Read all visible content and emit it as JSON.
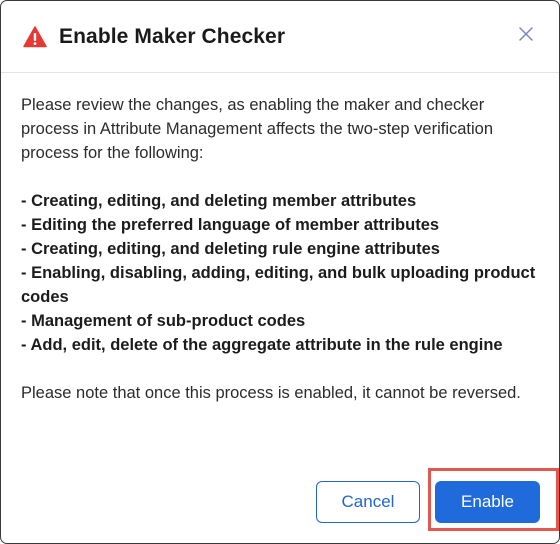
{
  "dialog": {
    "title": "Enable Maker Checker",
    "icon": "warning-icon",
    "close_icon": "close-icon",
    "intro": "Please review the changes, as enabling the maker and checker process in Attribute Management affects the two-step verification process for the following:",
    "bullets": [
      "- Creating, editing, and deleting member attributes",
      "- Editing the preferred language of member attributes",
      "- Creating, editing, and deleting rule engine attributes",
      "- Enabling, disabling, adding, editing, and bulk uploading product codes",
      "- Management of sub-product codes",
      "- Add, edit, delete of the aggregate attribute in the rule engine"
    ],
    "note": "Please note that once this process is enabled, it cannot be reversed.",
    "cancel_label": "Cancel",
    "enable_label": "Enable"
  },
  "colors": {
    "primary": "#1f6bdb",
    "warning": "#e53935",
    "highlight_outline": "#e0584f"
  }
}
